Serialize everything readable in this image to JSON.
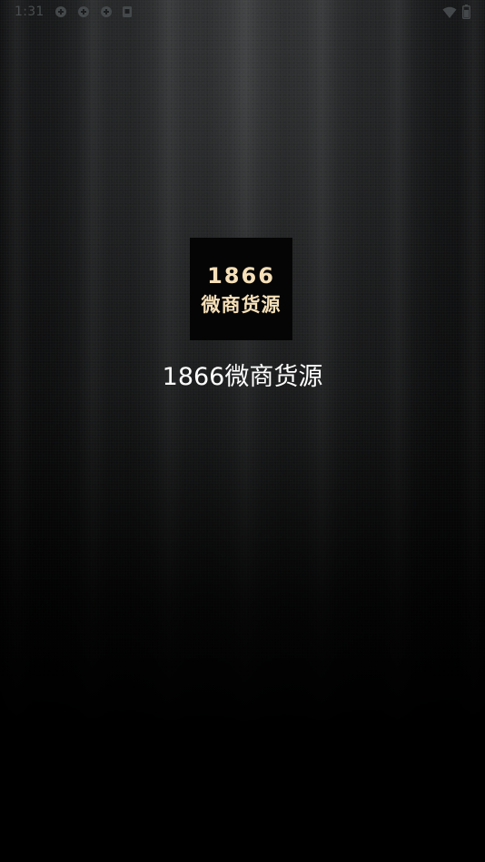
{
  "status_bar": {
    "time": "1:31",
    "notification_icons": [
      "app-notification-icon",
      "app-notification-icon",
      "app-notification-icon",
      "storage-icon"
    ],
    "right_icons": [
      "wifi-icon",
      "battery-icon"
    ]
  },
  "splash": {
    "logo": {
      "number": "1866",
      "name": "微商货源",
      "text_color": "#f5dfb8",
      "background": "#050505"
    },
    "app_title": "1866微商货源"
  }
}
